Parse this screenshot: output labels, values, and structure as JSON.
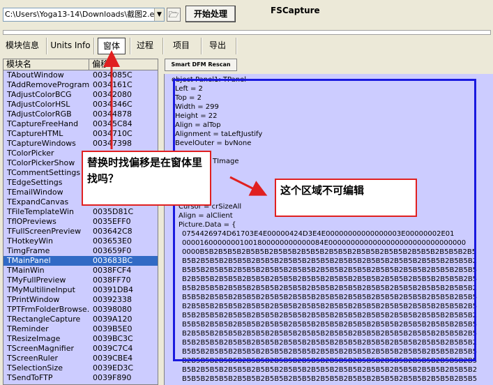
{
  "toolbar": {
    "path_value": "C:\\Users\\Yoga13-14\\Downloads\\截图2.exe",
    "dropdown_glyph": "▼",
    "open_glyph": "🗁",
    "start_label": "开始处理",
    "app_title": "FSCapture"
  },
  "tabs": [
    {
      "label": "模块信息"
    },
    {
      "label": "Units Info"
    },
    {
      "label": "窗体"
    },
    {
      "label": "过程"
    },
    {
      "label": "项目"
    },
    {
      "label": "导出"
    }
  ],
  "list": {
    "col_name": "模块名",
    "col_offset": "偏移",
    "rows": [
      {
        "name": "TAboutWindow",
        "offset": "0034085C"
      },
      {
        "name": "TAddRemovePrograms",
        "offset": "0034161C"
      },
      {
        "name": "TAdjustColorBCG",
        "offset": "00342080"
      },
      {
        "name": "TAdjustColorHSL",
        "offset": "0034346C"
      },
      {
        "name": "TAdjustColorRGB",
        "offset": "00344878"
      },
      {
        "name": "TCaptureFreeHand",
        "offset": "00345C84"
      },
      {
        "name": "TCaptureHTML",
        "offset": "0034710C"
      },
      {
        "name": "TCaptureWindows",
        "offset": "00347398"
      },
      {
        "name": "TColorPicker",
        "offset": ""
      },
      {
        "name": "TColorPickerShow",
        "offset": ""
      },
      {
        "name": "TCommentSettings",
        "offset": ""
      },
      {
        "name": "TEdgeSettings",
        "offset": ""
      },
      {
        "name": "TEmailWindow",
        "offset": ""
      },
      {
        "name": "TExpandCanvas",
        "offset": ""
      },
      {
        "name": "TFileTemplateWin",
        "offset": "0035D81C"
      },
      {
        "name": "TflOPreviews",
        "offset": "0035EFF0"
      },
      {
        "name": "TFullScreenPreview",
        "offset": "003642C8"
      },
      {
        "name": "THotkeyWin",
        "offset": "003653E0"
      },
      {
        "name": "TimgFrame",
        "offset": "003659F0"
      },
      {
        "name": "TMainPanel",
        "offset": "003683BC",
        "selected": true
      },
      {
        "name": "TMainWin",
        "offset": "0038FCF4"
      },
      {
        "name": "TMyFullPreview",
        "offset": "0038FF70"
      },
      {
        "name": "TMyMultilineInput",
        "offset": "00391DB4"
      },
      {
        "name": "TPrintWindow",
        "offset": "00392338"
      },
      {
        "name": "TPTFrmFolderBrowse...",
        "offset": "00398080"
      },
      {
        "name": "TRectangleCapture",
        "offset": "0039A120"
      },
      {
        "name": "TReminder",
        "offset": "0039B5E0"
      },
      {
        "name": "TResizeImage",
        "offset": "0039BC3C"
      },
      {
        "name": "TScreenMagnifier",
        "offset": "0039C7C4"
      },
      {
        "name": "TScreenRuler",
        "offset": "0039CBE4"
      },
      {
        "name": "TSelectionSize",
        "offset": "0039ED3C"
      },
      {
        "name": "TSendToFTP",
        "offset": "0039F890"
      }
    ]
  },
  "scan_button": "Smart DFM Rescan",
  "code_lines": [
    "object Panel1: TPanel",
    "Left = 2",
    "Top = 2",
    "Width = 299",
    "Height = 22",
    "Align = alTop",
    "Alignment = taLeftJustify",
    "BevelOuter = bvNone",
    "",
    "ge: TImage",
    "Cursor = crSizeAll",
    "Align = alClient",
    "Picture.Data = {",
    "0754426974D61703E4E00000424D3E4E00000000000000003E00000002E01",
    "00001600000001001800000000000084E0000000000000000000000000000000",
    "0000B5B2B5B5B2B5B5B2B5B5B2B5B5B2B5B5B2B5B5B2B5B5B2B5B5B2B5B5B2B5",
    "B5B2B5B5B2B5B5B2B5B5B2B5B5B2B5B5B2B5B5B2B5B5B2B5B5B2B5B5B2B5B5B2",
    "B5B5B2B5B5B2B5B5B2B5B5B2B5B5B2B5B5B2B5B5B2B5B5B2B5B5B2B5B5B2B5B5",
    "B2B5B5B2B5B5B2B5B5B2B5B5B2B5B5B2B5B5B2B5B5B2B5B5B2B5B5B2B5B5B2B5",
    "B5B2B5B5B2B5B5B2B5B5B2B5B5B2B5B5B2B5B5B2B5B5B2B5B5B2B5B5B2B5B5B2",
    "B5B5B2B5B5B2B5B5B2B5B5B2B5B5B2B5B5B2B5B5B2B5B5B2B5B5B2B5B5B2B5B5",
    "B2B5B5B2B5B5B2B5B5B2B5B5B2B5B5B2B5B5B2B5B5B2B5B5B2B5B5B2B5B5B2B5",
    "B5B2B5B5B2B5B5B2B5B5B2B5B5B2B5B5B2B5B5B2B5B5B2B5B5B2B5B5B2B5B5B2",
    "B5B5B2B5B5B2B5B5B2B5B5B2B5B5B2B5B5B2B5B5B2B5B5B2B5B5B2B5B5B2B5B5",
    "B2B5B5B2B5B5B2B5B5B2B5B5B2B5B5B2B5B5B2B5B5B2B5B5B2B5B5B2B5B5B2B5",
    "B5B2B5B5B2B5B5B2B5B5B2B5B5B2B5B5B2B5B5B2B5B5B2B5B5B2B5B5B2B5B5B2",
    "B5B5B2B5B5B2B5B5B2B5B5B2B5B5B2B5B5B2B5B5B2B5B5B2B5B5B2B5B5B2B5B5",
    "B2B5B5B2B5B5B2B5B5B2B5B5B2B5B5B2B5B5B2B5B5B2B5B5B2B5B5B2B5B5B2B5",
    "B5B2B5B5B2B5B5B2B5B5B2B5B5B2B5B5B2B5B5B2B5B5B2B5B5B2B5B5B2B5B5B2",
    "B5B5B2B5B5B2B5B5B2B5B5B2B5B5B2B5B5B2B5B5B2B5B5B2B5B5B2B5B5B2B5B5"
  ],
  "annotations": {
    "note1": "替换时找偏移是在窗体里找吗？",
    "note2": "这个区域不可编辑",
    "highlight_color": "#1a1adf",
    "arrow_color": "#e02020"
  }
}
